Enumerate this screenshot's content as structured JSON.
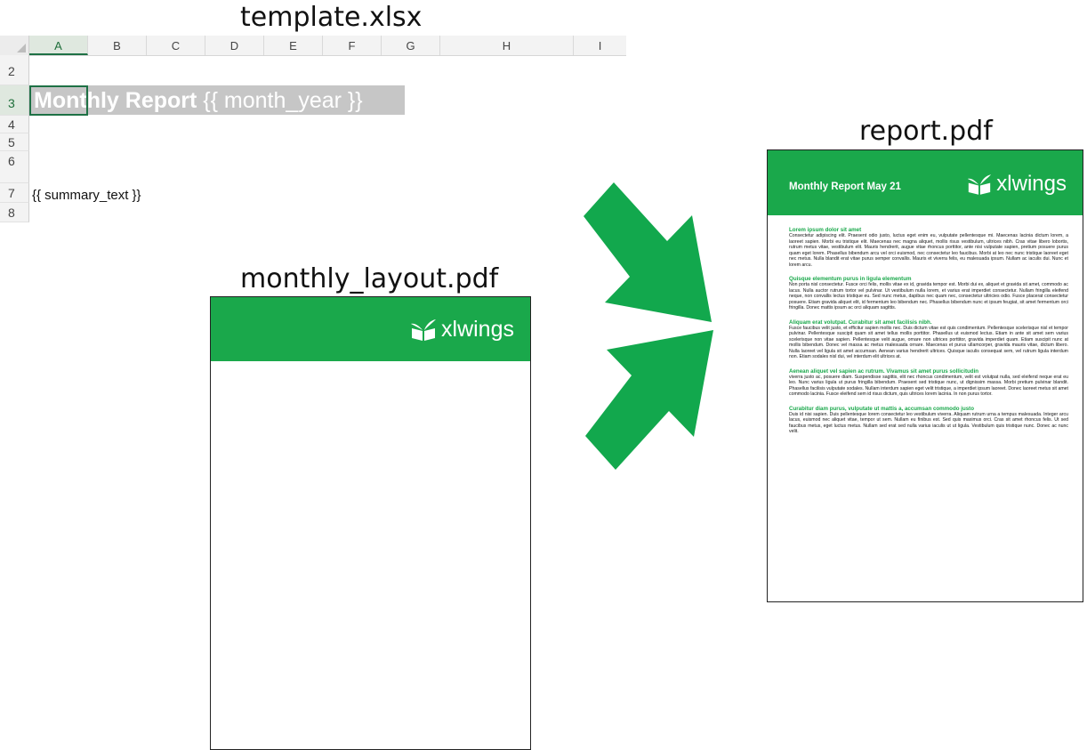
{
  "captions": {
    "template": "template.xlsx",
    "layout": "monthly_layout.pdf",
    "report": "report.pdf"
  },
  "spreadsheet": {
    "columns": [
      "A",
      "B",
      "C",
      "D",
      "E",
      "F",
      "G",
      "H",
      "I"
    ],
    "rows": [
      "2",
      "3",
      "4",
      "5",
      "6",
      "7",
      "8"
    ],
    "title_bold": "Monthly Report",
    "title_placeholder": "{{ month_year }}",
    "summary_placeholder": "{{ summary_text }}"
  },
  "layout_pdf": {
    "logo_text": "xlwings"
  },
  "report_pdf": {
    "title": "Monthly Report May 21",
    "logo_text": "xlwings",
    "sections": [
      {
        "heading": "Lorem ipsum dolor sit amet",
        "body": "Consectetur adipiscing elit. Praesent odio justo, luctus eget enim eu, vulputate pellentesque mi. Maecenas lacinia dictum lorem, a laoreet sapien. Morbi eu tristique elit. Maecenas nec magna aliquet, mollis risus vestibulum, ultrices nibh. Cras vitae libero lobortis, rutrum metus vitae, vestibulum elit. Mauris hendrerit, augue vitae rhoncus porttitor, ante nisi vulputate sapien, pretium posuere purus quam eget lorem. Phasellus bibendum arcu vel orci euismod, nec consectetur leo faucibus. Morbi at leo nec nunc tristique laoreet eget nec metus. Nulla blandit erat vitae purus semper convallis. Mauris et viverra felis, eu malesuada ipsum. Nullam ac iaculis dui. Nunc et lorem arcu."
      },
      {
        "heading": "Quisque elementum purus in ligula elementum",
        "body": "Non porta nisl consectetur. Fusce orci felis, mollis vitae ex id, gravida tempor est. Morbi dui ex, aliquet et gravida sit amet, commodo ac lacus. Nulla auctor rutrum tortor vel pulvinar. Ut vestibulum nulla lorem, et varius erat imperdiet consectetur. Nullam fringilla eleifend neque, non convallis lectus tristique eu. Sed nunc metus, dapibus nec quam nec, consectetur ultricies odio. Fusce placerat consectetur posuere. Etiam gravida aliquet elit, id fermentum leo bibendum nec. Phasellus bibendum nunc et ipsum feugiat, sit amet fermentum orci fringilla. Donec mattis ipsum ac orci aliquam sagittis."
      },
      {
        "heading": "Aliquam erat volutpat. Curabitur sit amet facilisis nibh.",
        "body": "Fusce faucibus velit justo, et efficitur sapien mollis nec. Duis dictum vitae est quis condimentum. Pellentesque scelerisque nisl et tempor pulvinar. Pellentesque suscipit quam sit amet tellus mollis porttitor. Phasellus ut euismod lectus. Etiam in ante sit amet sem varius scelerisque non vitae sapien. Pellentesque velit augue, ornare non ultrices porttitor, gravida imperdiet quam. Etiam suscipit nunc at mollis bibendum. Donec vel massa ac metus malesuada ornare. Maecenas et purus ullamcorper, gravida mauris vitae, dictum libero. Nulla laoreet vel ligula sit amet accumsan. Aenean varius hendrerit ultrices. Quisque iaculis consequat sem, vel rutrum ligula interdum non. Etiam sodales nisl dui, vel interdum elit ultrices at."
      },
      {
        "heading": "Aenean aliquet vel sapien ac rutrum. Vivamus sit amet purus sollicitudin",
        "body": "viverra justo ac, posuere diam. Suspendisse sagittis, elit nec rhoncus condimentum, velit est volutpat nulla, sed eleifend neque erat eu leo. Nunc varius ligula ut purus fringilla bibendum. Praesent sed tristique nunc, ut dignissim massa. Morbi pretium pulvinar blandit. Phasellus facilisis vulputate sodales. Nullam interdum sapien eget velit tristique, a imperdiet ipsum laoreet. Donec laoreet metus sit amet commodo lacinia. Fusce eleifend sem id risus dictum, quis ultrices lorem lacinia. In non purus tortor."
      },
      {
        "heading": "Curabitur diam purus, vulputate ut mattis a, accumsan commodo justo",
        "body": "Duis id nisi sapien. Duis pellentesque lorem consectetur leo vestibulum viverra. Aliquam rutrum urna a tempus malesuada. Integer arcu lacus, euismod nec aliquet vitae, tempor ut sem. Nullam eu finibus est. Sed quis maximus orci. Cras sit amet rhoncus felis. Ut sed faucibus metus, eget luctus metus. Nullam sed erat sed nulla varius iaculis ut ut ligula. Vestibulum quis tristique nunc. Donec ac nunc velit."
      }
    ]
  },
  "colors": {
    "brand_green": "#1aa84b",
    "arrow_green": "#12a84d",
    "excel_green": "#1e7145",
    "title_band_gray": "#c6c6c6"
  }
}
